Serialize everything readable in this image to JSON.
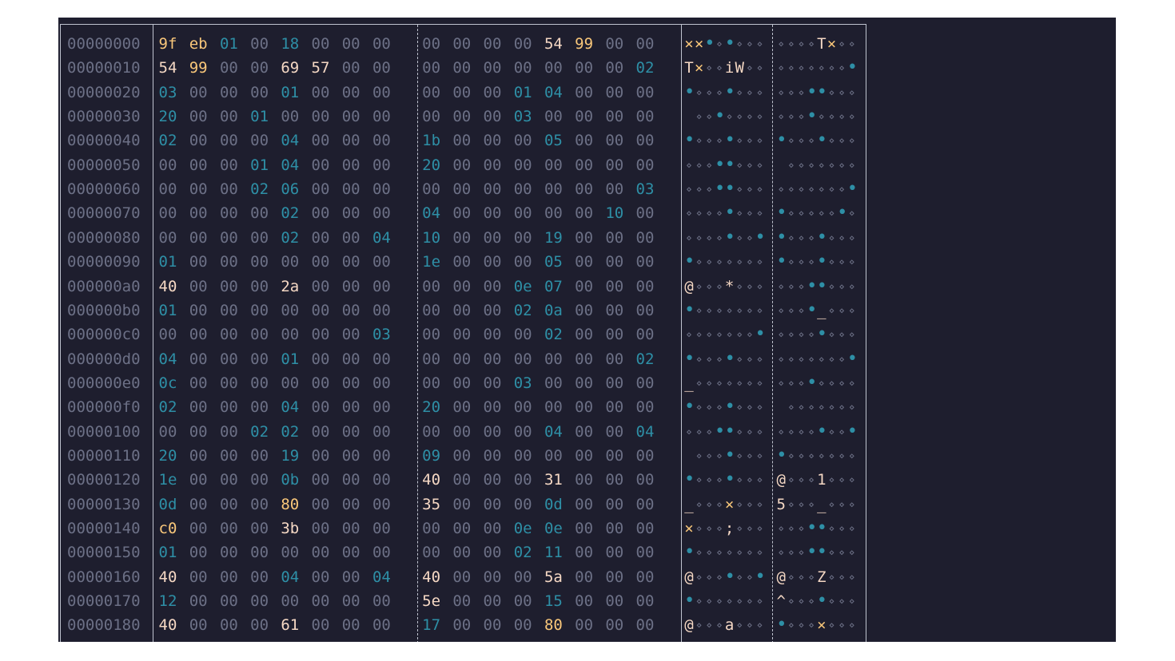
{
  "hexdump": {
    "rows": [
      {
        "offset": "00000000",
        "bytes": [
          "9f",
          "eb",
          "01",
          "00",
          "18",
          "00",
          "00",
          "00",
          "00",
          "00",
          "00",
          "00",
          "54",
          "99",
          "00",
          "00"
        ]
      },
      {
        "offset": "00000010",
        "bytes": [
          "54",
          "99",
          "00",
          "00",
          "69",
          "57",
          "00",
          "00",
          "00",
          "00",
          "00",
          "00",
          "00",
          "00",
          "00",
          "02"
        ]
      },
      {
        "offset": "00000020",
        "bytes": [
          "03",
          "00",
          "00",
          "00",
          "01",
          "00",
          "00",
          "00",
          "00",
          "00",
          "00",
          "01",
          "04",
          "00",
          "00",
          "00"
        ]
      },
      {
        "offset": "00000030",
        "bytes": [
          "20",
          "00",
          "00",
          "01",
          "00",
          "00",
          "00",
          "00",
          "00",
          "00",
          "00",
          "03",
          "00",
          "00",
          "00",
          "00"
        ]
      },
      {
        "offset": "00000040",
        "bytes": [
          "02",
          "00",
          "00",
          "00",
          "04",
          "00",
          "00",
          "00",
          "1b",
          "00",
          "00",
          "00",
          "05",
          "00",
          "00",
          "00"
        ]
      },
      {
        "offset": "00000050",
        "bytes": [
          "00",
          "00",
          "00",
          "01",
          "04",
          "00",
          "00",
          "00",
          "20",
          "00",
          "00",
          "00",
          "00",
          "00",
          "00",
          "00"
        ]
      },
      {
        "offset": "00000060",
        "bytes": [
          "00",
          "00",
          "00",
          "02",
          "06",
          "00",
          "00",
          "00",
          "00",
          "00",
          "00",
          "00",
          "00",
          "00",
          "00",
          "03"
        ]
      },
      {
        "offset": "00000070",
        "bytes": [
          "00",
          "00",
          "00",
          "00",
          "02",
          "00",
          "00",
          "00",
          "04",
          "00",
          "00",
          "00",
          "00",
          "00",
          "10",
          "00"
        ]
      },
      {
        "offset": "00000080",
        "bytes": [
          "00",
          "00",
          "00",
          "00",
          "02",
          "00",
          "00",
          "04",
          "10",
          "00",
          "00",
          "00",
          "19",
          "00",
          "00",
          "00"
        ]
      },
      {
        "offset": "00000090",
        "bytes": [
          "01",
          "00",
          "00",
          "00",
          "00",
          "00",
          "00",
          "00",
          "1e",
          "00",
          "00",
          "00",
          "05",
          "00",
          "00",
          "00"
        ]
      },
      {
        "offset": "000000a0",
        "bytes": [
          "40",
          "00",
          "00",
          "00",
          "2a",
          "00",
          "00",
          "00",
          "00",
          "00",
          "00",
          "0e",
          "07",
          "00",
          "00",
          "00"
        ]
      },
      {
        "offset": "000000b0",
        "bytes": [
          "01",
          "00",
          "00",
          "00",
          "00",
          "00",
          "00",
          "00",
          "00",
          "00",
          "00",
          "02",
          "0a",
          "00",
          "00",
          "00"
        ]
      },
      {
        "offset": "000000c0",
        "bytes": [
          "00",
          "00",
          "00",
          "00",
          "00",
          "00",
          "00",
          "03",
          "00",
          "00",
          "00",
          "00",
          "02",
          "00",
          "00",
          "00"
        ]
      },
      {
        "offset": "000000d0",
        "bytes": [
          "04",
          "00",
          "00",
          "00",
          "01",
          "00",
          "00",
          "00",
          "00",
          "00",
          "00",
          "00",
          "00",
          "00",
          "00",
          "02"
        ]
      },
      {
        "offset": "000000e0",
        "bytes": [
          "0c",
          "00",
          "00",
          "00",
          "00",
          "00",
          "00",
          "00",
          "00",
          "00",
          "00",
          "03",
          "00",
          "00",
          "00",
          "00"
        ]
      },
      {
        "offset": "000000f0",
        "bytes": [
          "02",
          "00",
          "00",
          "00",
          "04",
          "00",
          "00",
          "00",
          "20",
          "00",
          "00",
          "00",
          "00",
          "00",
          "00",
          "00"
        ]
      },
      {
        "offset": "00000100",
        "bytes": [
          "00",
          "00",
          "00",
          "02",
          "02",
          "00",
          "00",
          "00",
          "00",
          "00",
          "00",
          "00",
          "04",
          "00",
          "00",
          "04"
        ]
      },
      {
        "offset": "00000110",
        "bytes": [
          "20",
          "00",
          "00",
          "00",
          "19",
          "00",
          "00",
          "00",
          "09",
          "00",
          "00",
          "00",
          "00",
          "00",
          "00",
          "00"
        ]
      },
      {
        "offset": "00000120",
        "bytes": [
          "1e",
          "00",
          "00",
          "00",
          "0b",
          "00",
          "00",
          "00",
          "40",
          "00",
          "00",
          "00",
          "31",
          "00",
          "00",
          "00"
        ]
      },
      {
        "offset": "00000130",
        "bytes": [
          "0d",
          "00",
          "00",
          "00",
          "80",
          "00",
          "00",
          "00",
          "35",
          "00",
          "00",
          "00",
          "0d",
          "00",
          "00",
          "00"
        ]
      },
      {
        "offset": "00000140",
        "bytes": [
          "c0",
          "00",
          "00",
          "00",
          "3b",
          "00",
          "00",
          "00",
          "00",
          "00",
          "00",
          "0e",
          "0e",
          "00",
          "00",
          "00"
        ]
      },
      {
        "offset": "00000150",
        "bytes": [
          "01",
          "00",
          "00",
          "00",
          "00",
          "00",
          "00",
          "00",
          "00",
          "00",
          "00",
          "02",
          "11",
          "00",
          "00",
          "00"
        ]
      },
      {
        "offset": "00000160",
        "bytes": [
          "40",
          "00",
          "00",
          "00",
          "04",
          "00",
          "00",
          "04",
          "40",
          "00",
          "00",
          "00",
          "5a",
          "00",
          "00",
          "00"
        ]
      },
      {
        "offset": "00000170",
        "bytes": [
          "12",
          "00",
          "00",
          "00",
          "00",
          "00",
          "00",
          "00",
          "5e",
          "00",
          "00",
          "00",
          "15",
          "00",
          "00",
          "00"
        ]
      },
      {
        "offset": "00000180",
        "bytes": [
          "40",
          "00",
          "00",
          "00",
          "61",
          "00",
          "00",
          "00",
          "17",
          "00",
          "00",
          "00",
          "80",
          "00",
          "00",
          "00"
        ]
      }
    ]
  },
  "colors": {
    "background": "#1e1e2e",
    "frame": "#bfc3cf",
    "null_byte": "#6c7086",
    "control_byte": "#2e8fa6",
    "printable_byte": "#f5d8c4",
    "high_byte": "#f9c77a"
  }
}
